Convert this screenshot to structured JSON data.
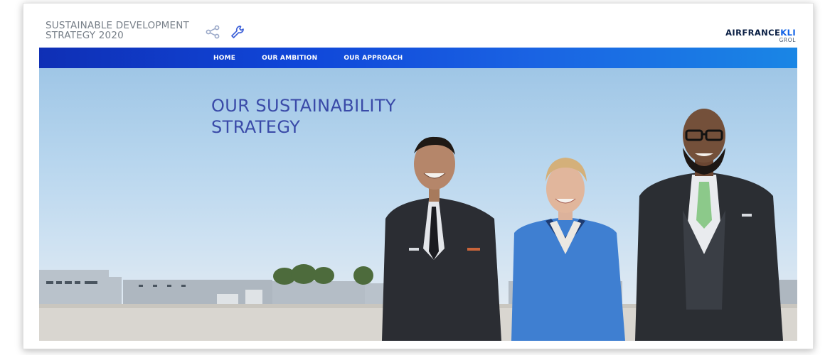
{
  "header": {
    "doc_title": "SUSTAINABLE DEVELOPMENT STRATEGY 2020",
    "brand_prefix": "AIRFRANCE",
    "brand_suffix": "KLI",
    "brand_sub": "GROL",
    "icons": [
      "share-icon",
      "wrench-icon"
    ]
  },
  "nav": {
    "items": [
      {
        "label": "HOME"
      },
      {
        "label": "OUR AMBITION"
      },
      {
        "label": "OUR APPROACH"
      }
    ]
  },
  "hero": {
    "title": "OUR SUSTAINABILITY STRATEGY"
  },
  "colors": {
    "nav_start": "#0f2fb5",
    "nav_end": "#1a86e5",
    "title": "#3a4aa8",
    "brand_accent": "#0d5fe6"
  }
}
